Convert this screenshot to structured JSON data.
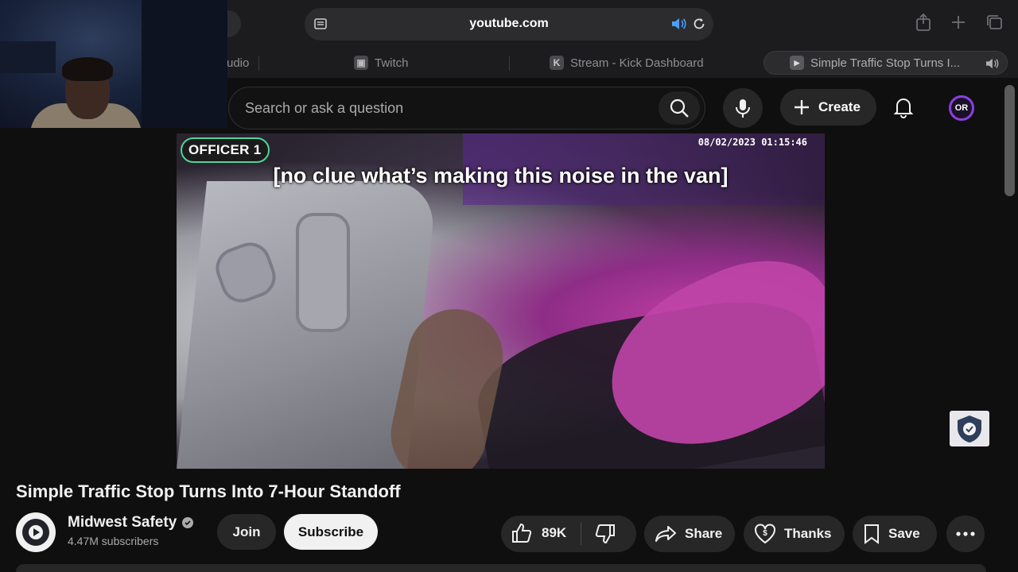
{
  "browser": {
    "url": "youtube.com",
    "tabs": [
      {
        "label": "udio"
      },
      {
        "label": "Twitch"
      },
      {
        "label": "Stream - Kick Dashboard"
      },
      {
        "label": "Simple Traffic Stop Turns I..."
      }
    ]
  },
  "header": {
    "search_placeholder": "Search or ask a question",
    "create_label": "Create",
    "avatar_initials": "OR"
  },
  "video": {
    "officer_label": "OFFICER 1",
    "timestamp": "08/02/2023 01:15:46",
    "caption": "[no clue what’s making this noise in the van]"
  },
  "watch": {
    "title": "Simple Traffic Stop Turns Into 7-Hour Standoff",
    "channel_name": "Midwest Safety",
    "subscribers": "4.47M subscribers",
    "join_label": "Join",
    "subscribe_label": "Subscribe",
    "like_count": "89K",
    "share_label": "Share",
    "thanks_label": "Thanks",
    "save_label": "Save"
  },
  "colors": {
    "background": "#0f0f0f",
    "officer_border": "#4fd59a",
    "avatar_ring": "#8b3fe0"
  }
}
